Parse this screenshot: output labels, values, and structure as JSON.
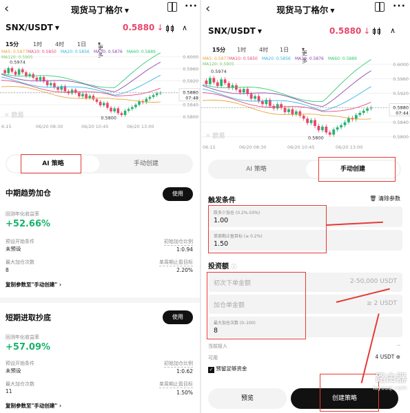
{
  "left": {
    "title": "现货马丁格尔",
    "pair": "SNX/USDT",
    "price": "0.5880",
    "price_arrow": "↓",
    "timeframes": [
      "15分",
      "1时",
      "4时",
      "1日",
      "更多"
    ],
    "ma_labels": [
      "MA5: 0.5877",
      "MA10: 0.5850",
      "MA20: 0.5856",
      "MA30: 0.5876",
      "MA60: 0.5889",
      "MA120: 0.5905"
    ],
    "ma_colors": [
      "#e8a23a",
      "#e84a7a",
      "#33b5e5",
      "#8e44ad",
      "#2ecc71",
      "#7bc96f"
    ],
    "y_ticks": [
      "0.6000",
      "0.5960",
      "0.5920",
      "0.5880",
      "0.5840",
      "0.5800"
    ],
    "price_tag": "0.5880",
    "time_tag": "07:48",
    "high_label": "0.5974",
    "low_label": "0.5800",
    "x_ticks": [
      "6:15",
      "06/20 08:30",
      "06/20 10:45",
      "06/20 13:00"
    ],
    "watermark": "欧易",
    "tabs": [
      "AI 策略",
      "手动创建"
    ],
    "strategies": [
      {
        "name": "中期趋势加仓",
        "use": "使用",
        "return_label": "回测年化收益率",
        "return_value": "+52.66%",
        "start_label": "预设开始条件",
        "start_value": "未预设",
        "ratio_label": "初始加仓比例",
        "ratio_value": "1:0.94",
        "max_label": "最大加仓次数",
        "max_value": "8",
        "tp_label": "单周期止盈目标",
        "tp_value": "2.20%",
        "copy": "复制参数至\"手动创建\""
      },
      {
        "name": "短期进取抄底",
        "use": "使用",
        "return_label": "回测年化收益率",
        "return_value": "+57.09%",
        "start_label": "预设开始条件",
        "start_value": "未预设",
        "ratio_label": "初始加仓比例",
        "ratio_value": "1:0.62",
        "max_label": "最大加仓次数",
        "max_value": "11",
        "tp_label": "单周期止盈目标",
        "tp_value": "1.50%",
        "copy": "复制参数至\"手动创建\""
      }
    ]
  },
  "right": {
    "title": "现货马丁格尔",
    "pair": "SNX/USDT",
    "price": "0.5880",
    "price_arrow": "↓",
    "timeframes": [
      "15分",
      "1时",
      "4时",
      "1日",
      "更多"
    ],
    "ma_labels": [
      "MA5: 0.5877",
      "MA10: 0.5850",
      "MA20: 0.5856",
      "MA30: 0.5876",
      "MA60: 0.5889",
      "MA120: 0.5905"
    ],
    "y_ticks": [
      "0.6000",
      "0.5960",
      "0.5920",
      "0.5880",
      "0.5840",
      "0.5800"
    ],
    "price_tag": "0.5880",
    "time_tag": "07:44",
    "high_label": "0.5974",
    "low_label": "0.5800",
    "x_ticks": [
      "06:15",
      "06/20 08:30",
      "06/20 10:45",
      "06/20 13:00"
    ],
    "watermark": "欧易",
    "tabs": [
      "AI 策略",
      "手动创建"
    ],
    "trigger_title": "触发条件",
    "clear_params": "清除参数",
    "fields": [
      {
        "label": "跌多少加仓 (0.2%-50%)",
        "value": "1.00"
      },
      {
        "label": "单周期止盈目标 (≥ 0.2%)",
        "value": "1.50"
      }
    ],
    "invest_title": "投资额",
    "invest_fields": [
      {
        "placeholder": "初次下单金额",
        "hint": "2-50,000 USDT"
      },
      {
        "placeholder": "加仓单金额",
        "hint": "≥ 2 USDT"
      }
    ],
    "max_field": {
      "label": "最大加仓次数 (0–100)",
      "value": "8"
    },
    "current_invest_label": "当前投入",
    "current_invest_value": "--",
    "available_label": "可用",
    "available_value": "4 USDT",
    "reserve_label": "预留足够资金",
    "preview": "预览",
    "create": "创建策略",
    "site_watermark": "路由器",
    "site_url": "luyouqi.com"
  }
}
